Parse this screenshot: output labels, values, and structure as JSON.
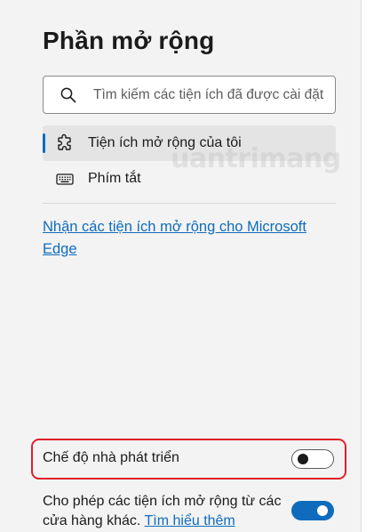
{
  "page": {
    "title": "Phần mở rộng"
  },
  "search": {
    "placeholder": "Tìm kiếm các tiện ích đã được cài đặt",
    "icon": "search-icon"
  },
  "nav": {
    "items": [
      {
        "label": "Tiện ích mở rộng của tôi",
        "icon": "extension-puzzle-icon",
        "active": true
      },
      {
        "label": "Phím tắt",
        "icon": "keyboard-icon",
        "active": false
      }
    ]
  },
  "get_extensions": {
    "link_text": "Nhận các tiện ích mở rộng cho Microsoft Edge"
  },
  "developer_mode": {
    "label": "Chế độ nhà phát triển",
    "enabled": false
  },
  "allow_other_stores": {
    "text": "Cho phép các tiện ích mở rộng từ các cửa hàng khác.",
    "learn_more": "Tìm hiểu thêm",
    "enabled": true
  },
  "watermark": {
    "text": "uantrimang"
  },
  "colors": {
    "accent": "#0f6cbd",
    "highlight_border": "#e0202a",
    "background": "#f3f3f3"
  }
}
